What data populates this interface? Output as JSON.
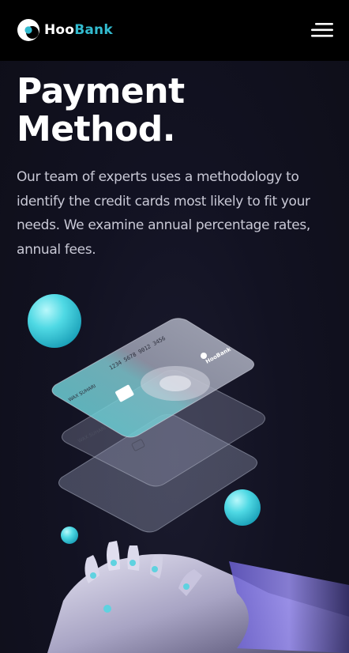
{
  "navbar": {
    "brand": {
      "part1": "Hoo",
      "part2": "Bank",
      "icon": "hoobank-logo-icon"
    },
    "menu_icon": "hamburger-menu-icon"
  },
  "hero": {
    "title_line1": "Payment",
    "title_line2": "Method.",
    "description": "Our team of experts uses a methodology to identify the credit cards most likely to fit your needs. We examine annual percentage rates, annual fees."
  },
  "illustration": {
    "card_front": {
      "number": "1234 5678 9012 3456",
      "holder": "WAX SUHARI",
      "brand": "HooBank"
    },
    "card_back": {
      "holder": "WAX SUHARI"
    }
  },
  "colors": {
    "background": "#0d0d17",
    "navbar": "#000000",
    "accent": "#33bbcf",
    "title": "#ffffff",
    "text": "#c9c9d6"
  }
}
